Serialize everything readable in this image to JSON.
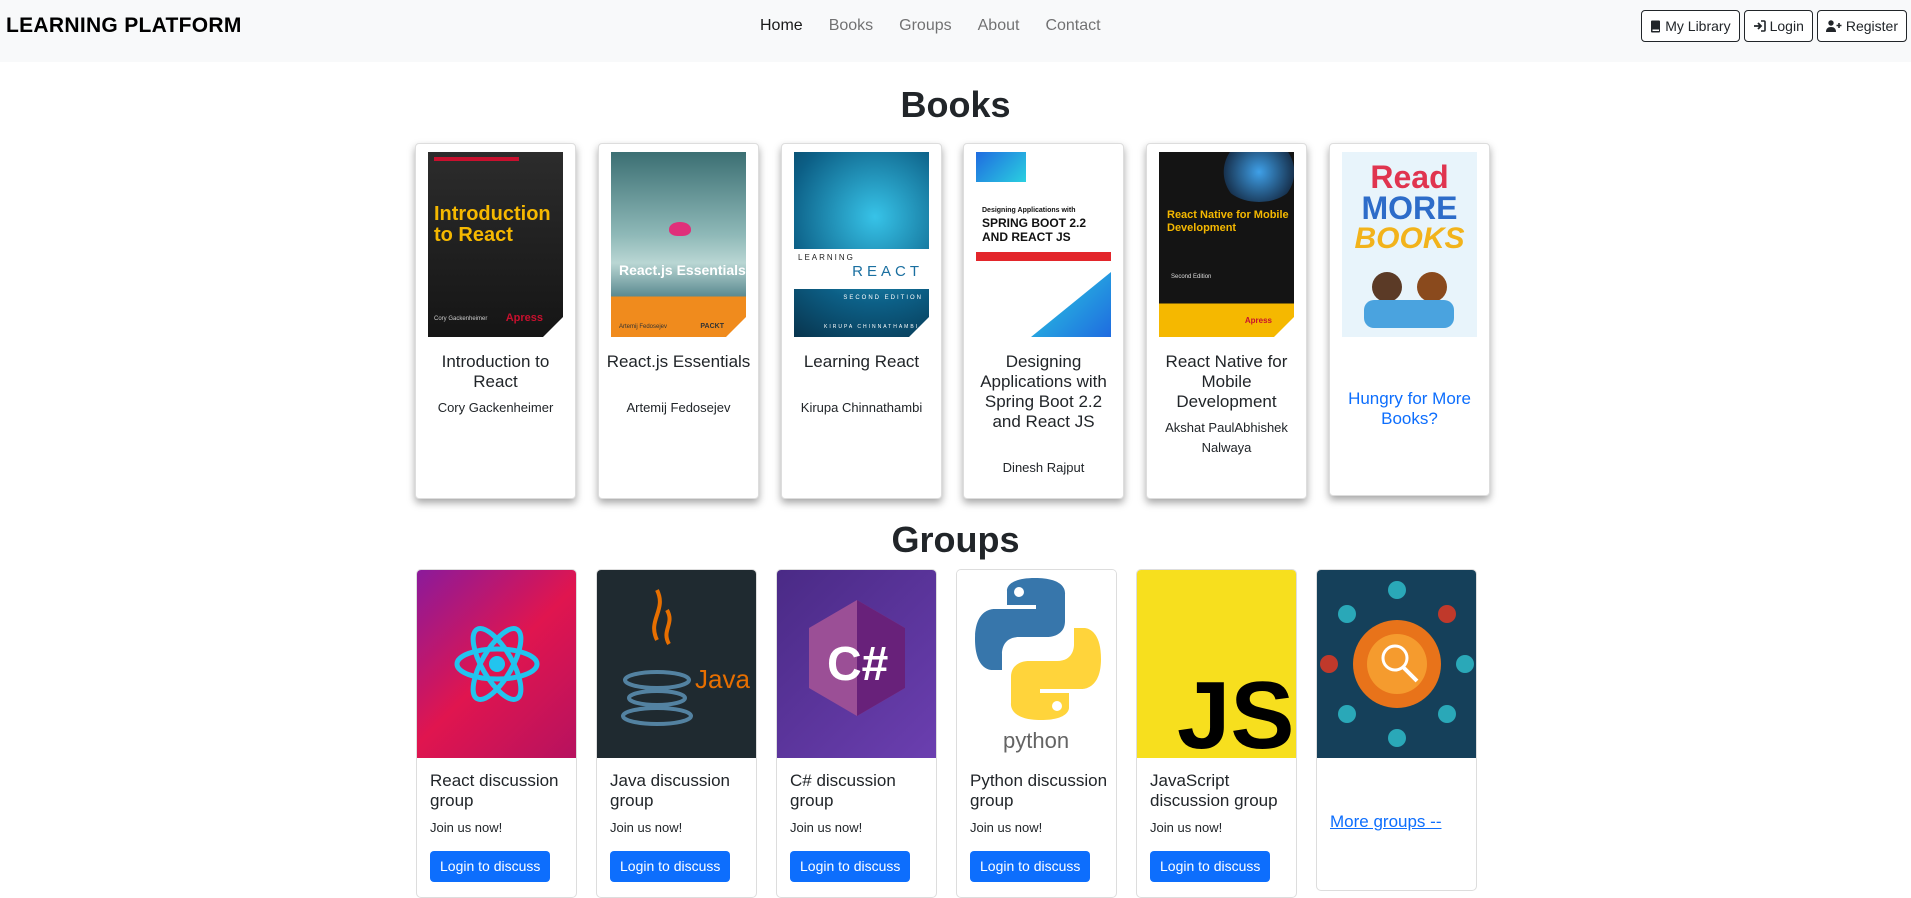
{
  "navbar": {
    "brand": "LEARNING PLATFORM",
    "links": [
      "Home",
      "Books",
      "Groups",
      "About",
      "Contact"
    ],
    "buttons": {
      "my_library": "My Library",
      "login": "Login",
      "register": "Register"
    }
  },
  "books_section": {
    "title": "Books",
    "items": [
      {
        "title": "Introduction to React",
        "author": "Cory Gackenheimer",
        "cover_title": "Introduction to React",
        "cover_publisher": "Apress",
        "cover_author": "Cory Gackenheimer"
      },
      {
        "title": "React.js Essentials",
        "author": "Artemij Fedosejev",
        "cover_title": "React.js Essentials",
        "cover_publisher": "PACKT",
        "cover_author": "Artemij Fedosejev"
      },
      {
        "title": "Learning React",
        "author": "Kirupa Chinnathambi",
        "cover_word1": "LEARNING",
        "cover_word2": "REACT",
        "cover_sub": "SECOND EDITION",
        "cover_author": "KIRUPA CHINNATHAMBI"
      },
      {
        "title": "Designing Applications with Spring Boot 2.2 and React JS",
        "author": "Dinesh Rajput",
        "cover_line1": "Designing Applications with",
        "cover_line2": "SPRING BOOT 2.2",
        "cover_line3": "AND REACT JS"
      },
      {
        "title": "React Native for Mobile Development",
        "author": "Akshat PaulAbhishek Nalwaya",
        "cover_title": "React Native for Mobile Development",
        "cover_sub": "Second Edition",
        "cover_publisher": "Apress"
      }
    ],
    "more": {
      "label": "Hungry for More Books?",
      "cover_line1": "Read",
      "cover_line2": "MORE",
      "cover_line3": "BOOKS"
    }
  },
  "groups_section": {
    "title": "Groups",
    "items": [
      {
        "title": "React discussion group",
        "subtitle": "Join us now!",
        "button": "Login to discuss"
      },
      {
        "title": "Java discussion group",
        "subtitle": "Join us now!",
        "button": "Login to discuss",
        "logo_text": "Java"
      },
      {
        "title": "C# discussion group",
        "subtitle": "Join us now!",
        "button": "Login to discuss",
        "logo_text": "C#"
      },
      {
        "title": "Python discussion group",
        "subtitle": "Join us now!",
        "button": "Login to discuss",
        "logo_text": "python"
      },
      {
        "title": "JavaScript discussion group",
        "subtitle": "Join us now!",
        "button": "Login to discuss",
        "logo_text": "JS"
      }
    ],
    "more": {
      "label": "More groups --"
    }
  },
  "colors": {
    "primary": "#0d6efd",
    "navbar_bg": "#f8f9fa",
    "text": "#212529"
  }
}
